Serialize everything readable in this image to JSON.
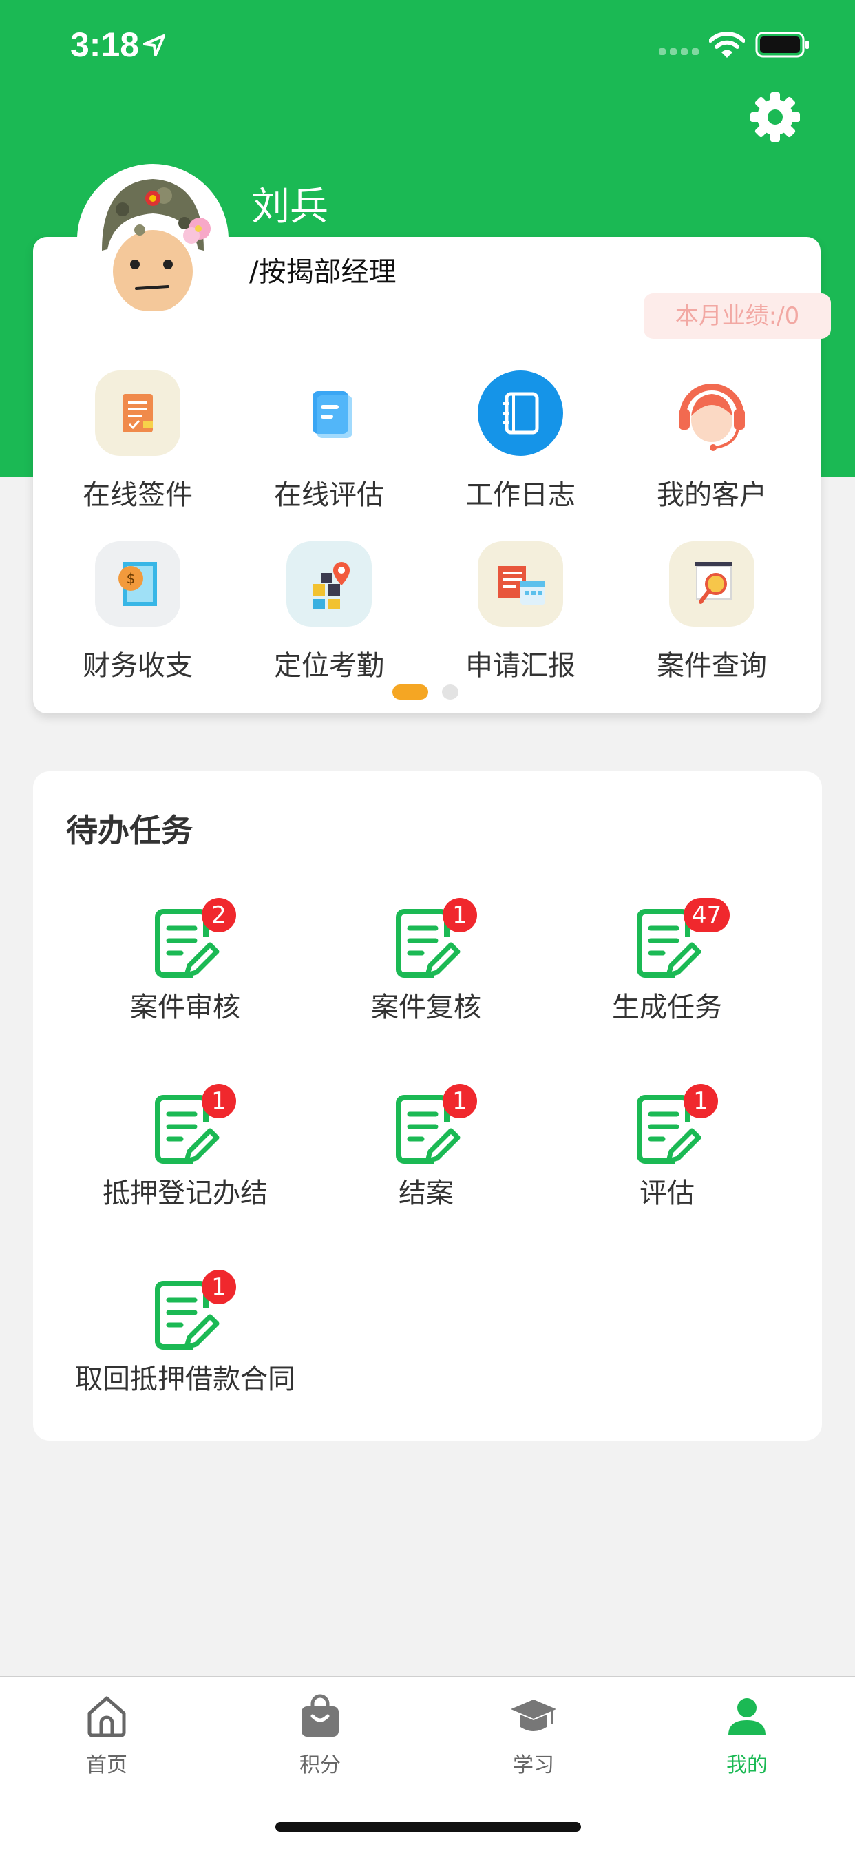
{
  "status_bar": {
    "time": "3:18"
  },
  "colors": {
    "brand_green": "#1bb954",
    "badge_red": "#f0282d",
    "page_dot_active": "#f5a623"
  },
  "profile": {
    "name": "刘兵",
    "title": "/按揭部经理",
    "performance": "本月业绩:/0"
  },
  "quick_grid": [
    {
      "label": "在线签件",
      "icon": "contract-sign-icon"
    },
    {
      "label": "在线评估",
      "icon": "assessment-doc-icon"
    },
    {
      "label": "工作日志",
      "icon": "notebook-icon"
    },
    {
      "label": "我的客户",
      "icon": "customer-service-icon"
    },
    {
      "label": "财务收支",
      "icon": "finance-icon"
    },
    {
      "label": "定位考勤",
      "icon": "location-checkin-icon"
    },
    {
      "label": "申请汇报",
      "icon": "report-calendar-icon"
    },
    {
      "label": "案件查询",
      "icon": "case-search-icon"
    }
  ],
  "tasks": {
    "title": "待办任务",
    "items": [
      {
        "label": "案件审核",
        "count": "2"
      },
      {
        "label": "案件复核",
        "count": "1"
      },
      {
        "label": "生成任务",
        "count": "47"
      },
      {
        "label": "抵押登记办结",
        "count": "1"
      },
      {
        "label": "结案",
        "count": "1"
      },
      {
        "label": "评估",
        "count": "1"
      },
      {
        "label": "取回抵押借款合同",
        "count": "1"
      }
    ]
  },
  "tab_bar": {
    "items": [
      {
        "label": "首页",
        "icon": "home-icon"
      },
      {
        "label": "积分",
        "icon": "shopping-bag-icon"
      },
      {
        "label": "学习",
        "icon": "graduation-cap-icon"
      },
      {
        "label": "我的",
        "icon": "person-icon",
        "active": true
      }
    ]
  }
}
